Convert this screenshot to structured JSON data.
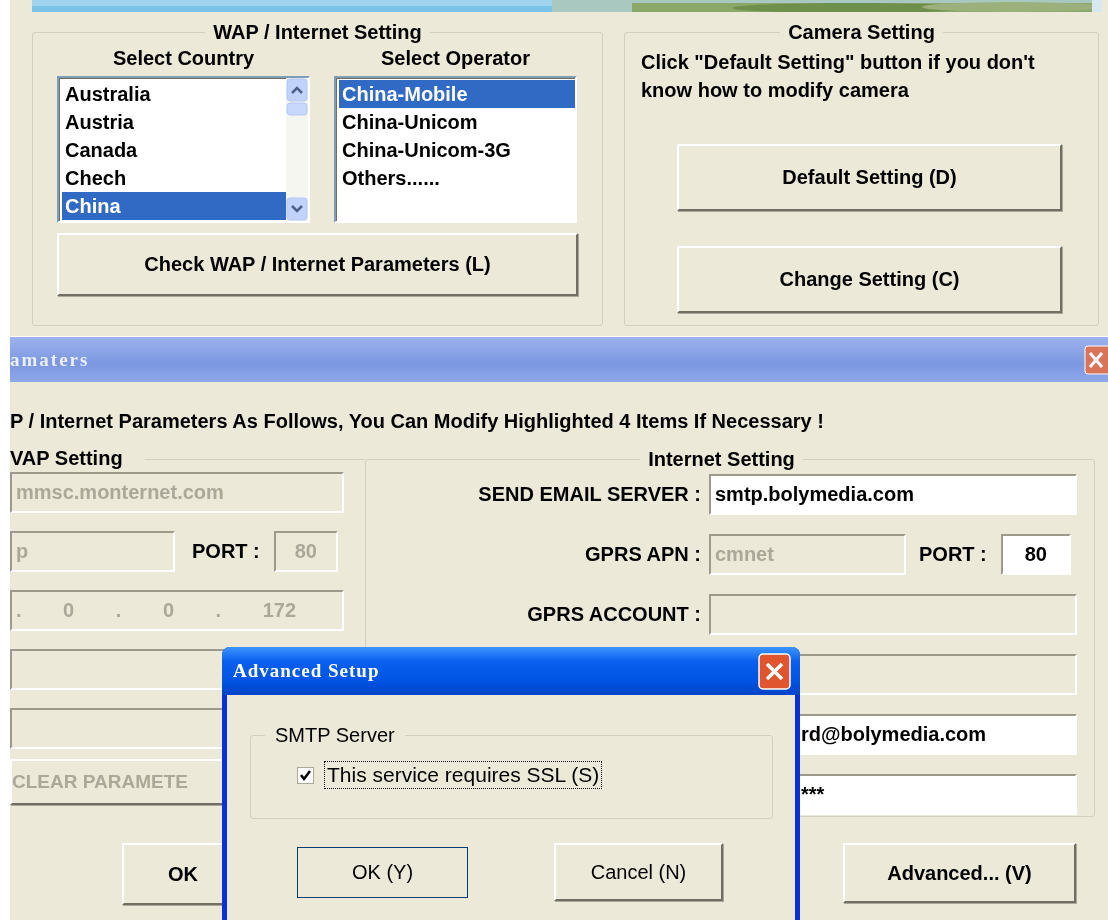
{
  "main_window": {
    "wap_group": {
      "title": "WAP / Internet Setting",
      "country_label": "Select Country",
      "operator_label": "Select Operator",
      "countries": [
        {
          "label": "Australia",
          "selected": false
        },
        {
          "label": "Austria",
          "selected": false
        },
        {
          "label": "Canada",
          "selected": false
        },
        {
          "label": "Chech",
          "selected": false
        },
        {
          "label": "China",
          "selected": true
        }
      ],
      "operators": [
        {
          "label": "China-Mobile",
          "selected": true
        },
        {
          "label": "China-Unicom",
          "selected": false
        },
        {
          "label": "China-Unicom-3G",
          "selected": false
        },
        {
          "label": "Others......",
          "selected": false
        }
      ],
      "button": "Check WAP / Internet Parameters (L)"
    },
    "camera_group": {
      "title": "Camera Setting",
      "hint": "Click \"Default Setting\" button if you don't know how to modify camera",
      "buttons": [
        "Default Setting (D)",
        "Change Setting (C)"
      ]
    }
  },
  "parameters_window": {
    "title": "amaters",
    "message": "P / Internet Parameters As Follows, You Can Modify Highlighted 4 Items If Necessary !",
    "wap_setting": {
      "title": "VAP Setting",
      "mmsc": {
        "value": "mmsc.monternet.com",
        "disabled": true
      },
      "gateway": {
        "value": "p",
        "disabled": true
      },
      "port_label": "PORT :",
      "port": {
        "value": "80",
        "disabled": true
      },
      "ip": {
        "value": ". 0 . 0 . 172",
        "disabled": true
      },
      "extra_fields": [
        {
          "disabled": true
        },
        {
          "disabled": true
        }
      ],
      "clear_button": {
        "label": "CLEAR PARAMETE",
        "disabled": true
      }
    },
    "internet_setting": {
      "title": "Internet Setting",
      "rows": [
        {
          "label": "SEND EMAIL SERVER :",
          "value": "smtp.bolymedia.com",
          "disabled": false
        },
        {
          "label": "GPRS APN :",
          "value": "cmnet",
          "disabled": true,
          "port_label": "PORT :",
          "port": "80",
          "port_disabled": false
        },
        {
          "label": "GPRS ACCOUNT :",
          "disabled": true
        },
        {
          "disabled": true
        },
        {
          "value": "rd@bolymedia.com",
          "disabled": false
        },
        {
          "value": "***",
          "disabled": false
        }
      ]
    },
    "ok_button": "OK",
    "advanced_button": "Advanced... (V)"
  },
  "advanced_dialog": {
    "title": "Advanced Setup",
    "group_title": "SMTP Server",
    "ssl": {
      "label": "This service requires SSL (S)",
      "checked": true
    },
    "ok_button": "OK (Y)",
    "cancel_button": "Cancel (N)"
  }
}
